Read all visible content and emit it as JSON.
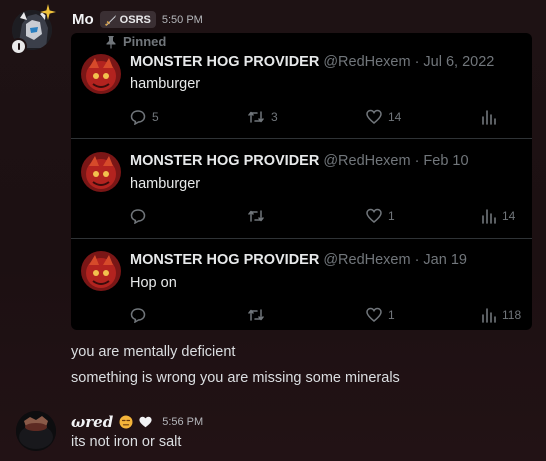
{
  "message1": {
    "username": "Mo",
    "tag_label": "OSRS",
    "timestamp": "5:50 PM"
  },
  "embed": {
    "pinned_label": "Pinned",
    "tweets": [
      {
        "name": "MONSTER HOG PROVIDER",
        "handle": "@RedHexem",
        "separator": "·",
        "date": "Jul 6, 2022",
        "text": "hamburger",
        "replies": "5",
        "retweets": "3",
        "likes": "14",
        "views": ""
      },
      {
        "name": "MONSTER HOG PROVIDER",
        "handle": "@RedHexem",
        "separator": "·",
        "date": "Feb 10",
        "text": "hamburger",
        "replies": "",
        "retweets": "",
        "likes": "1",
        "views": "14"
      },
      {
        "name": "MONSTER HOG PROVIDER",
        "handle": "@RedHexem",
        "separator": "·",
        "date": "Jan 19",
        "text": "Hop on",
        "replies": "",
        "retweets": "",
        "likes": "1",
        "views": "118"
      }
    ]
  },
  "followups": [
    "you are mentally deficient",
    "something is wrong you are missing some minerals"
  ],
  "message2": {
    "username": "ωred",
    "timestamp": "5:56 PM",
    "text": "its not iron or salt"
  },
  "colors": {
    "background": "#1e1214",
    "embed_bg": "#000000",
    "muted": "#71767b",
    "divider": "#2f3336"
  }
}
